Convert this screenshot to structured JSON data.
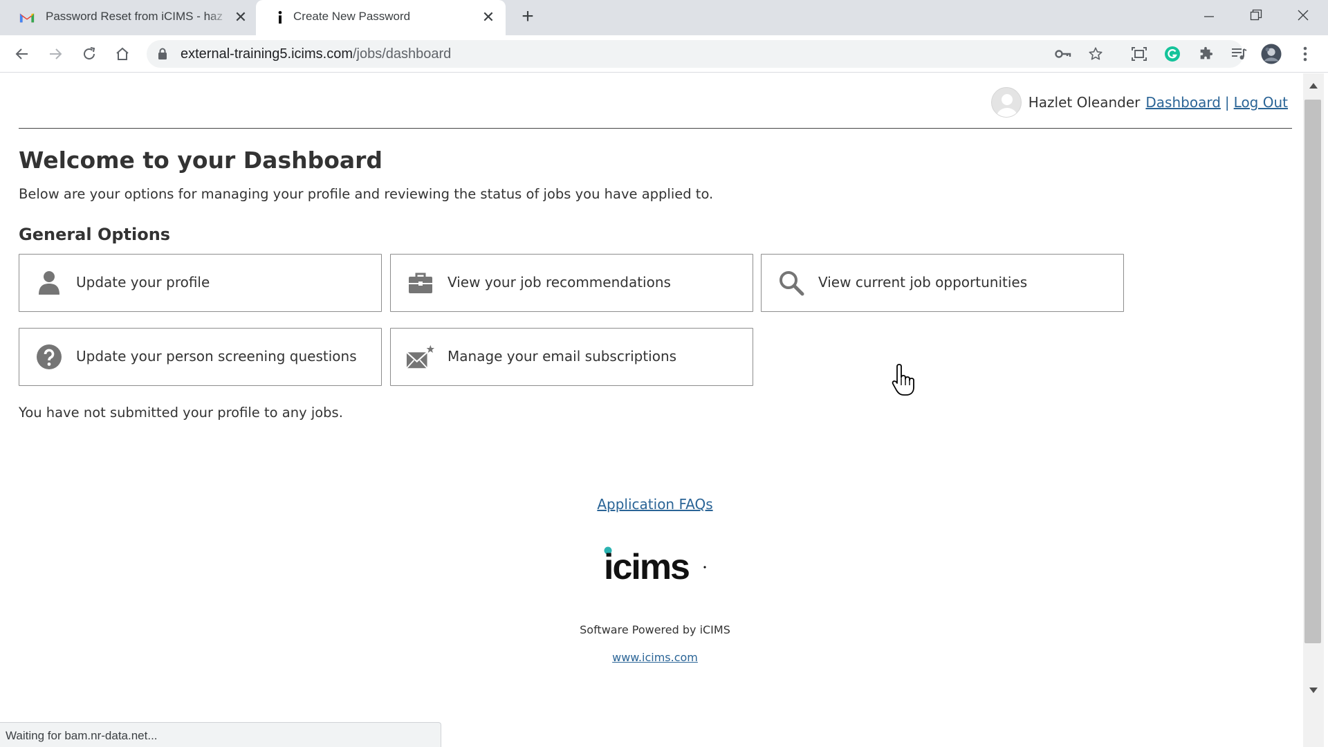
{
  "browser": {
    "tabs": [
      {
        "title": "Password Reset from iCIMS - haz",
        "favicon": "gmail-icon",
        "active": false
      },
      {
        "title": "Create New Password",
        "favicon": "icims-icon",
        "active": true
      }
    ],
    "url_domain": "external-training5.icims.com",
    "url_path": "/jobs/dashboard",
    "status_text": "Waiting for bam.nr-data.net..."
  },
  "header": {
    "user_name": "Hazlet Oleander",
    "dashboard_link": "Dashboard",
    "separator": "|",
    "logout_link": "Log Out"
  },
  "main": {
    "title": "Welcome to your Dashboard",
    "intro": "Below are your options for managing your profile and reviewing the status of jobs you have applied to.",
    "section_title": "General Options",
    "options": [
      {
        "label": "Update your profile",
        "icon": "person-icon"
      },
      {
        "label": "View your job recommendations",
        "icon": "briefcase-icon"
      },
      {
        "label": "View current job opportunities",
        "icon": "search-icon"
      },
      {
        "label": "Update your person screening questions",
        "icon": "question-icon"
      },
      {
        "label": "Manage your email subscriptions",
        "icon": "envelope-star-icon"
      }
    ],
    "no_jobs_text": "You have not submitted your profile to any jobs."
  },
  "footer": {
    "faq_link": "Application FAQs",
    "logo_text": "icims",
    "powered_text": "Software Powered by iCIMS",
    "site_link": "www.icims.com"
  },
  "colors": {
    "link": "#2a6496",
    "icon_gray": "#757575",
    "logo_teal": "#2bb3b1",
    "grammarly_green": "#15c39a"
  }
}
